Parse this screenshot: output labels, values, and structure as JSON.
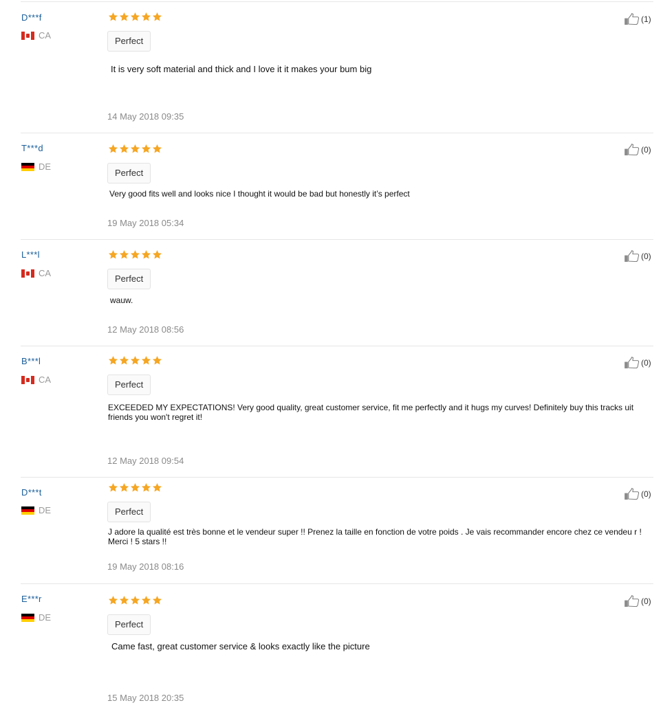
{
  "reviews": [
    {
      "user": "D***f",
      "country": "CA",
      "flag": "ca",
      "rating": 5,
      "tag": "Perfect",
      "text": "It is very soft material and thick and I love it it makes your bum big",
      "date": "14 May 2018 09:35",
      "helpful": "(1)"
    },
    {
      "user": "T***d",
      "country": "DE",
      "flag": "de",
      "rating": 5,
      "tag": "Perfect",
      "text": "Very good fits well and looks nice I thought it would be bad but honestly it’s perfect",
      "date": "19 May 2018 05:34",
      "helpful": "(0)"
    },
    {
      "user": "L***l",
      "country": "CA",
      "flag": "ca",
      "rating": 5,
      "tag": "Perfect",
      "text": "wauw.",
      "date": "12 May 2018 08:56",
      "helpful": "(0)"
    },
    {
      "user": "B***l",
      "country": "CA",
      "flag": "ca",
      "rating": 5,
      "tag": "Perfect",
      "text": "EXCEEDED MY EXPECTATIONS! Very good quality, great customer service, fit me perfectly and it hugs my curves! Definitely buy this tracks uit friends you won't regret it!",
      "date": "12 May 2018 09:54",
      "helpful": "(0)"
    },
    {
      "user": "D***t",
      "country": "DE",
      "flag": "de",
      "rating": 5,
      "tag": "Perfect",
      "text": "J adore la qualité est très bonne et le vendeur super !! Prenez la taille en fonction de votre poids . Je vais recommander encore chez ce vendeu r ! Merci ! 5 stars !!",
      "date": "19 May 2018 08:16",
      "helpful": "(0)"
    },
    {
      "user": "E***r",
      "country": "DE",
      "flag": "de",
      "rating": 5,
      "tag": "Perfect",
      "text": "Came fast, great customer service & looks exactly like the picture",
      "date": "15 May 2018 20:35",
      "helpful": "(0)"
    }
  ],
  "colors": {
    "star": "#f5a623",
    "username": "#1a5e9a",
    "muted": "#8a8a8a"
  }
}
